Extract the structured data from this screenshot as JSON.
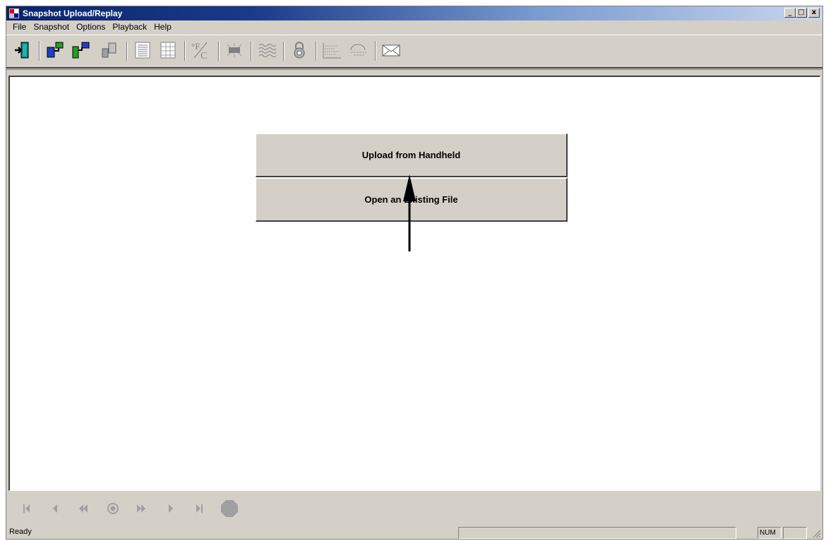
{
  "window": {
    "title": "Snapshot Upload/Replay",
    "controls": [
      "_",
      "□",
      "x"
    ]
  },
  "menu": [
    "File",
    "Snapshot",
    "Options",
    "Playback",
    "Help"
  ],
  "toolbar_icons": [
    "exit-icon",
    "connect-icon",
    "transfer-icon",
    "copy-icon",
    "list-icon",
    "grid-icon",
    "fahrenheit-celsius-icon",
    "chip-icon",
    "waveform-icon",
    "lock-icon",
    "graph-icon",
    "scan-icon",
    "mail-icon"
  ],
  "main": {
    "upload_button": "Upload from Handheld",
    "open_button": "Open an Existing File"
  },
  "playback_icons": [
    "first-icon",
    "prev-icon",
    "rewind-icon",
    "record-icon",
    "fast-forward-icon",
    "next-icon",
    "last-icon",
    "stop-icon"
  ],
  "status": {
    "text": "Ready",
    "num": "NUM"
  },
  "colors": {
    "face": "#d4d0c8",
    "titlebar": "#0a246a",
    "client": "#ffffff"
  }
}
